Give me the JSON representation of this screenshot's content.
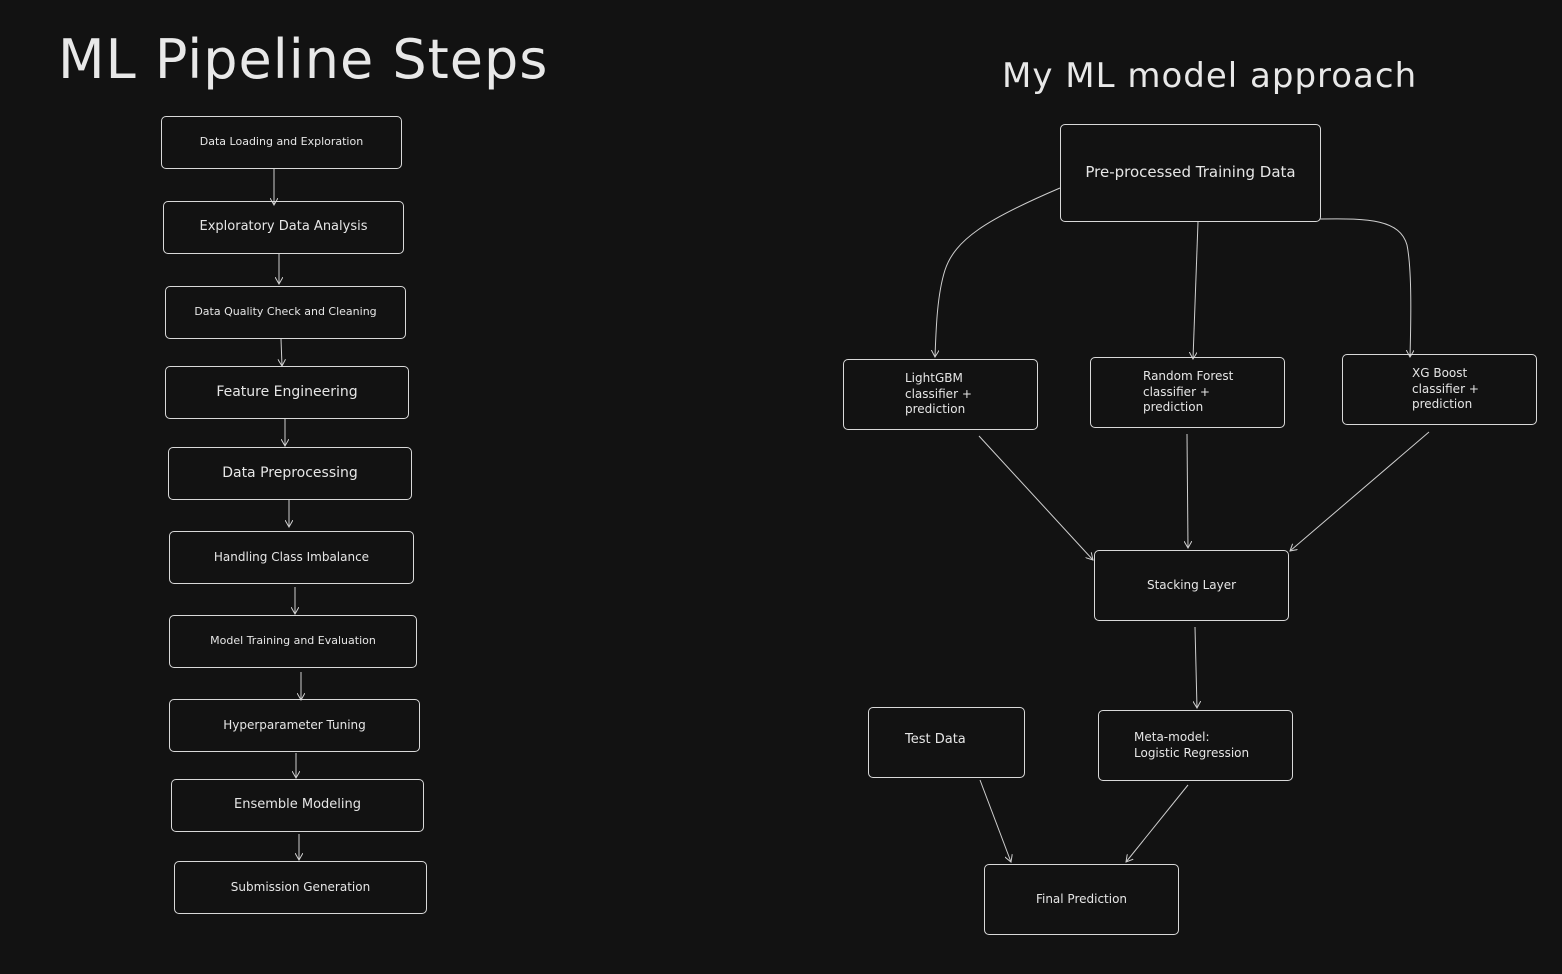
{
  "titles": {
    "left": "ML Pipeline Steps",
    "right": "My ML model approach"
  },
  "pipeline": {
    "steps": [
      "Data Loading and Exploration",
      "Exploratory Data Analysis",
      "Data Quality Check and Cleaning",
      "Feature Engineering",
      "Data Preprocessing",
      "Handling Class Imbalance",
      "Model Training and Evaluation",
      "Hyperparameter Tuning",
      "Ensemble Modeling",
      "Submission Generation"
    ]
  },
  "approach": {
    "training_data": "Pre-processed Training Data",
    "lightgbm": "LightGBM\nclassifier +\nprediction",
    "random_forest": "Random Forest\nclassifier +\nprediction",
    "xgboost": "XG Boost\nclassifier +\nprediction",
    "stacking": "Stacking Layer",
    "meta_model": "Meta-model:\nLogistic Regression",
    "test_data": "Test Data",
    "final": "Final Prediction"
  },
  "colors": {
    "background": "#121212",
    "stroke": "#d9d9d9",
    "text": "#e6e6e6"
  }
}
